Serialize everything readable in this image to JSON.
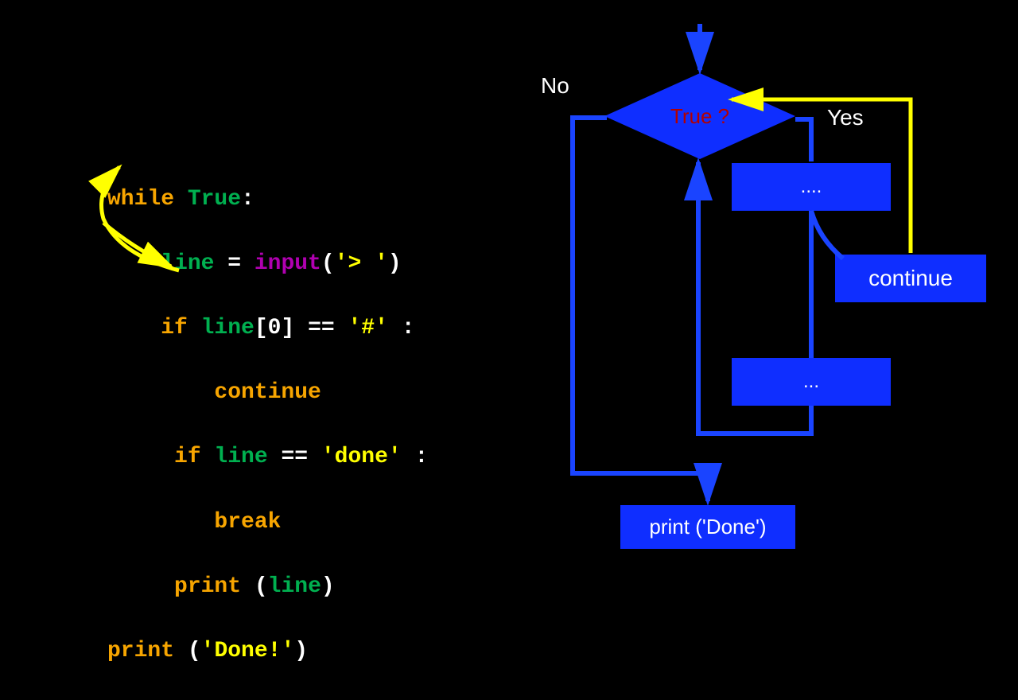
{
  "code": {
    "l1_while": "while ",
    "l1_true": "True",
    "l1_colon": ":",
    "l2_line": "    line ",
    "l2_eq": "= ",
    "l2_input": "input",
    "l2_paren_open": "(",
    "l2_str": "'> '",
    "l2_paren_close": ")",
    "l3_if": "    if ",
    "l3_line": "line",
    "l3_idx": "[0] ",
    "l3_eqeq": "== ",
    "l3_str": "'#'",
    "l3_colon": " :",
    "l4_continue": "        continue",
    "l5_if": "     if ",
    "l5_line": "line ",
    "l5_eqeq": "== ",
    "l5_str": "'done'",
    "l5_colon": " :",
    "l6_break": "        break",
    "l7_print": "     print ",
    "l7_paren_open": "(",
    "l7_line": "line",
    "l7_paren_close": ")",
    "l8_print": "print ",
    "l8_paren_open": "(",
    "l8_str": "'Done!'",
    "l8_paren_close": ")"
  },
  "flow": {
    "decision": "True ?",
    "no": "No",
    "yes": "Yes",
    "box1": "....",
    "continue": "continue",
    "box2": "...",
    "done": "print ('Done')"
  }
}
